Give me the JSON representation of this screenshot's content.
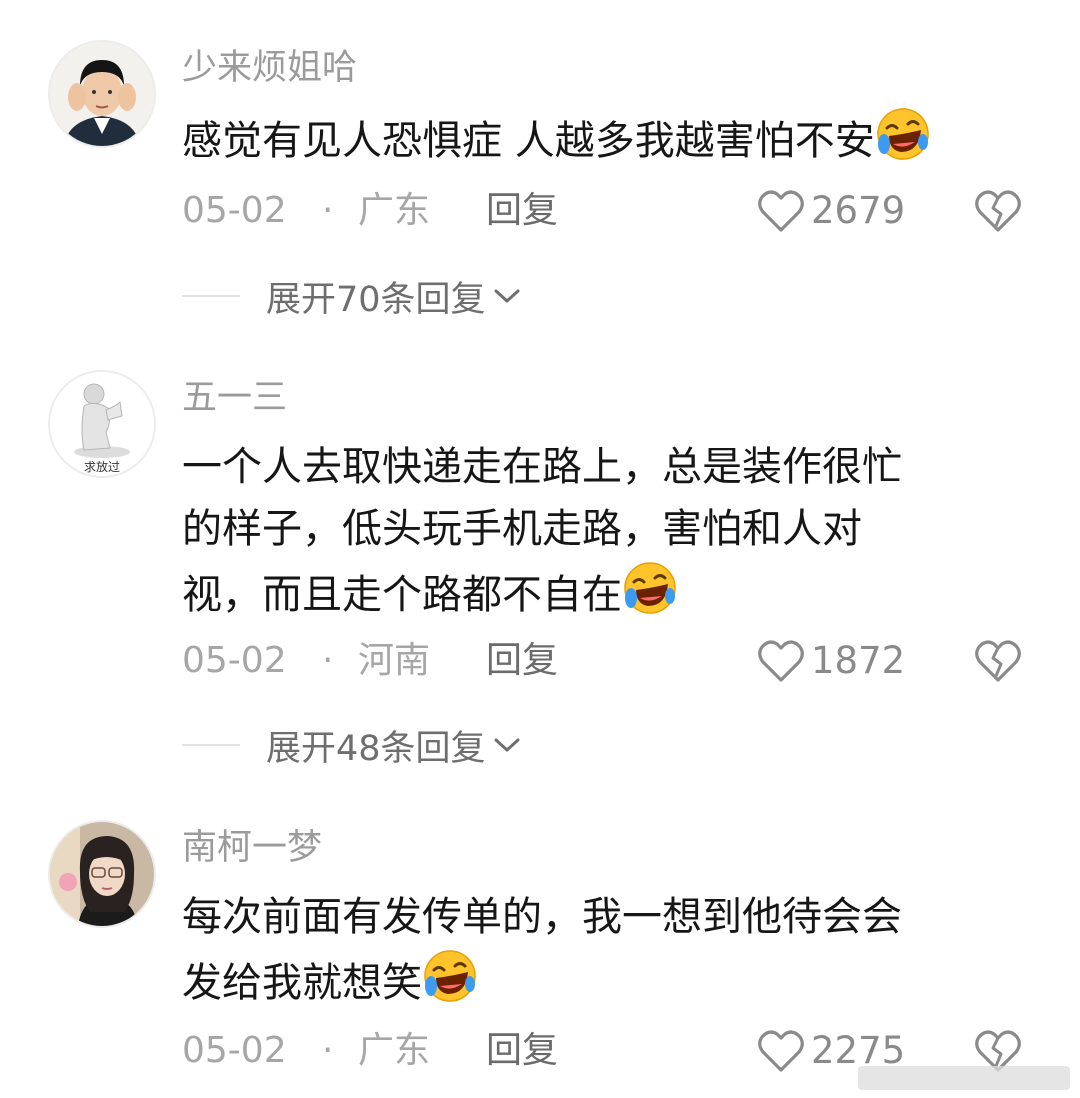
{
  "comments": [
    {
      "username": "少来烦姐哈",
      "content": "感觉有见人恐惧症 人越多我越害怕不安",
      "emoji": "laugh-cry-emoji",
      "date": "05-02",
      "separator": "·",
      "region": "广东",
      "reply_label": "回复",
      "likes": "2679",
      "expand_label": "展开70条回复"
    },
    {
      "username": "五一三",
      "avatar_caption": "求放过",
      "content_lines": [
        "一个人去取快递走在路上，总是装作很忙",
        "的样子，低头玩手机走路，害怕和人对",
        "视，而且走个路都不自在"
      ],
      "emoji": "laugh-cry-emoji",
      "date": "05-02",
      "separator": "·",
      "region": "河南",
      "reply_label": "回复",
      "likes": "1872",
      "expand_label": "展开48条回复"
    },
    {
      "username": "南柯一梦",
      "content_lines": [
        "每次前面有发传单的，我一想到他待会会",
        "发给我就想笑"
      ],
      "emoji": "laugh-cry-emoji",
      "date": "05-02",
      "separator": "·",
      "region": "广东",
      "reply_label": "回复",
      "likes": "2275"
    }
  ],
  "icons": {
    "like": "heart-outline-icon",
    "dislike": "broken-heart-icon",
    "expand": "chevron-down-icon"
  },
  "colors": {
    "text_primary": "#161616",
    "text_secondary": "#9b9b9b",
    "background": "#ffffff"
  }
}
